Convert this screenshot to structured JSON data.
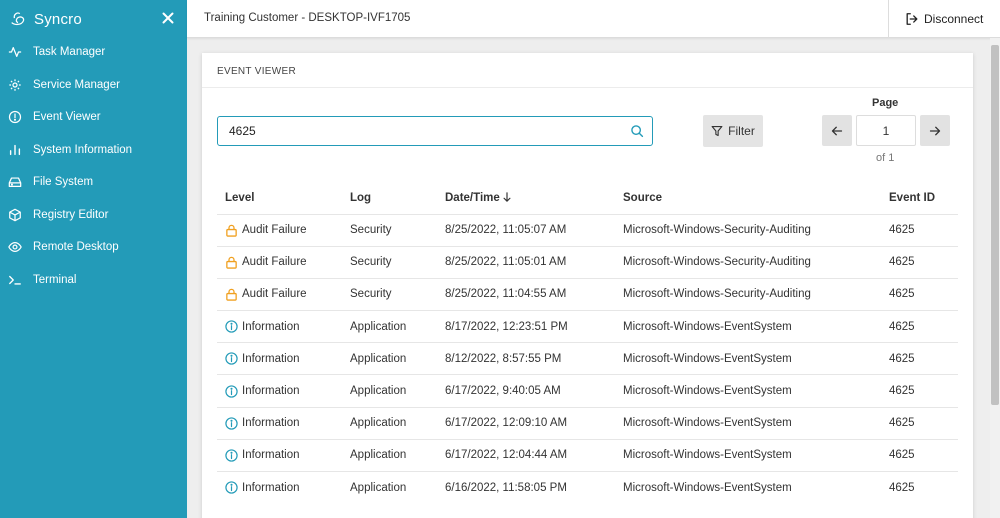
{
  "app": {
    "name": "Syncro"
  },
  "sidebar": {
    "items": [
      {
        "label": "Task Manager",
        "icon": "activity-icon"
      },
      {
        "label": "Service Manager",
        "icon": "gear-icon"
      },
      {
        "label": "Event Viewer",
        "icon": "alert-circle-icon"
      },
      {
        "label": "System Information",
        "icon": "bar-chart-icon"
      },
      {
        "label": "File System",
        "icon": "hard-drive-icon"
      },
      {
        "label": "Registry Editor",
        "icon": "cube-icon"
      },
      {
        "label": "Remote Desktop",
        "icon": "eye-icon"
      },
      {
        "label": "Terminal",
        "icon": "terminal-icon"
      }
    ]
  },
  "topbar": {
    "device": "Training Customer - DESKTOP-IVF1705",
    "disconnect": "Disconnect"
  },
  "card": {
    "title": "EVENT VIEWER"
  },
  "search": {
    "value": "4625"
  },
  "filter": {
    "label": "Filter"
  },
  "pagination": {
    "label": "Page",
    "current": "1",
    "of": "of 1"
  },
  "table": {
    "headers": [
      "Level",
      "Log",
      "Date/Time",
      "Source",
      "Event ID"
    ],
    "rows": [
      {
        "level": "Audit Failure",
        "log": "Security",
        "datetime": "8/25/2022, 11:05:07 AM",
        "source": "Microsoft-Windows-Security-Auditing",
        "event_id": "4625"
      },
      {
        "level": "Audit Failure",
        "log": "Security",
        "datetime": "8/25/2022, 11:05:01 AM",
        "source": "Microsoft-Windows-Security-Auditing",
        "event_id": "4625"
      },
      {
        "level": "Audit Failure",
        "log": "Security",
        "datetime": "8/25/2022, 11:04:55 AM",
        "source": "Microsoft-Windows-Security-Auditing",
        "event_id": "4625"
      },
      {
        "level": "Information",
        "log": "Application",
        "datetime": "8/17/2022, 12:23:51 PM",
        "source": "Microsoft-Windows-EventSystem",
        "event_id": "4625"
      },
      {
        "level": "Information",
        "log": "Application",
        "datetime": "8/12/2022, 8:57:55 PM",
        "source": "Microsoft-Windows-EventSystem",
        "event_id": "4625"
      },
      {
        "level": "Information",
        "log": "Application",
        "datetime": "6/17/2022, 9:40:05 AM",
        "source": "Microsoft-Windows-EventSystem",
        "event_id": "4625"
      },
      {
        "level": "Information",
        "log": "Application",
        "datetime": "6/17/2022, 12:09:10 AM",
        "source": "Microsoft-Windows-EventSystem",
        "event_id": "4625"
      },
      {
        "level": "Information",
        "log": "Application",
        "datetime": "6/17/2022, 12:04:44 AM",
        "source": "Microsoft-Windows-EventSystem",
        "event_id": "4625"
      },
      {
        "level": "Information",
        "log": "Application",
        "datetime": "6/16/2022, 11:58:05 PM",
        "source": "Microsoft-Windows-EventSystem",
        "event_id": "4625"
      }
    ]
  },
  "colors": {
    "sidebar": "#239bb8",
    "audit_failure": "#f0a020",
    "information": "#239bb8",
    "accent": "#239bb8"
  }
}
